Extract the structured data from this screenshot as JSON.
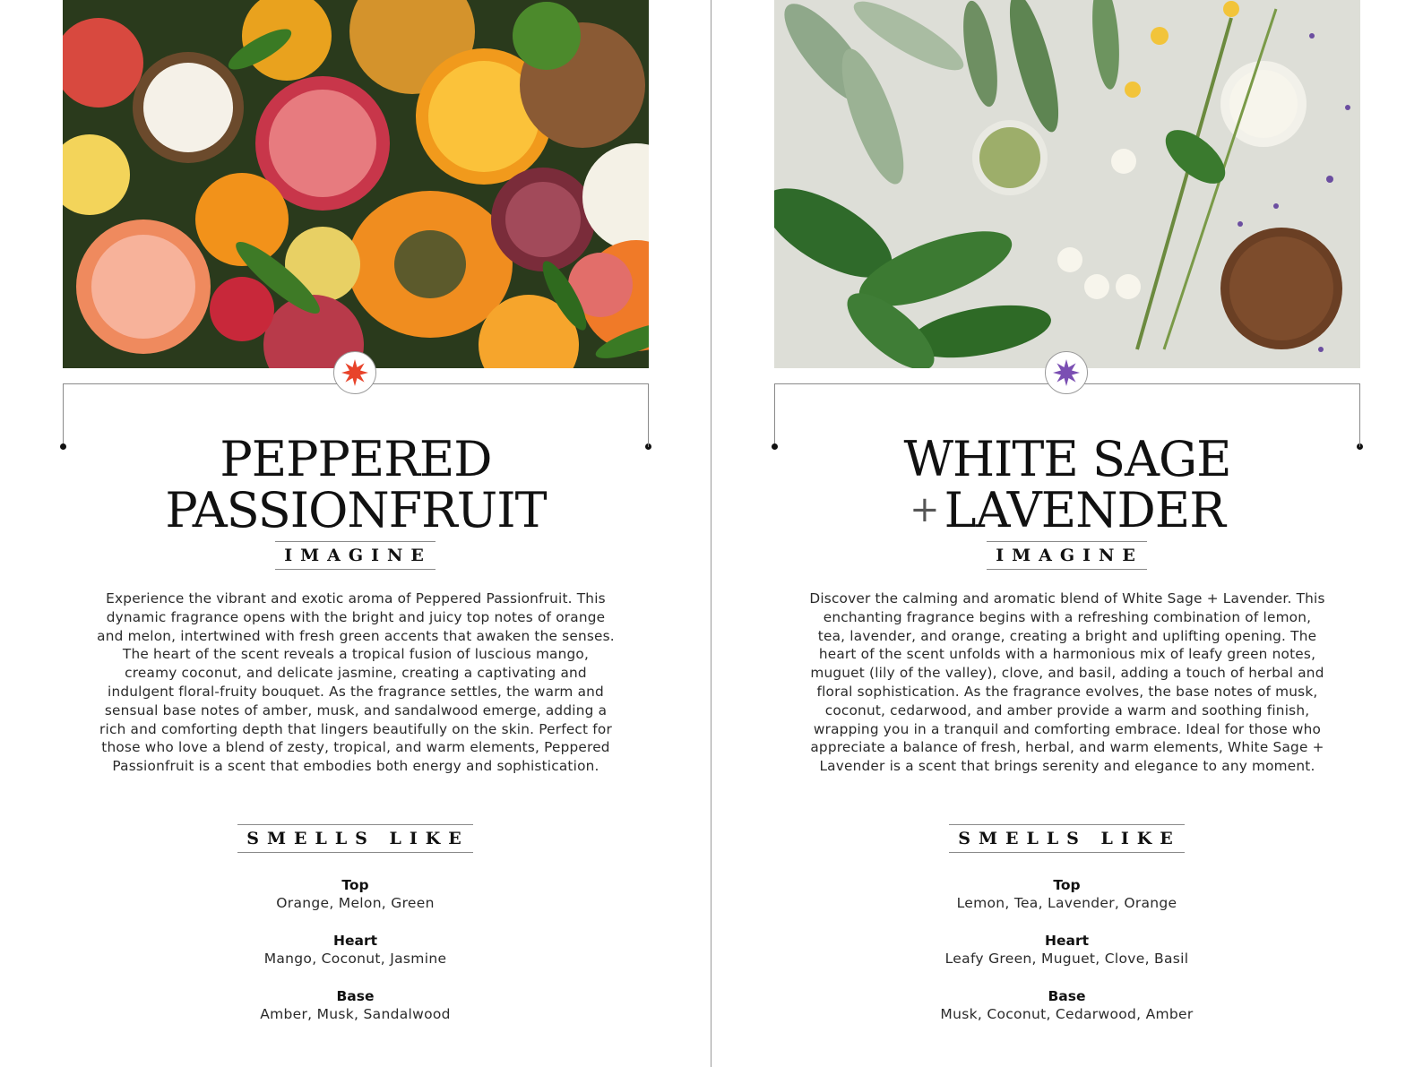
{
  "colors": {
    "left_badge_star": "#e8432a",
    "right_badge_star": "#7b4fb3",
    "text": "#222222",
    "rule": "#8a8a8a"
  },
  "cards": [
    {
      "photo": "tropical-fruit-photo",
      "badge_icon": "star-burst-icon",
      "title_line1": "PEPPERED",
      "title_line2": "PASSIONFRUIT",
      "imagine_label": "IMAGINE",
      "description": "Experience the vibrant and exotic aroma of Peppered Passionfruit. This dynamic fragrance opens with the bright and juicy top notes of orange and melon, intertwined with fresh green accents that awaken the senses. The heart of the scent reveals a tropical fusion of luscious mango, creamy coconut, and delicate jasmine, creat­ing a captivating and indulgent floral-fruity bouquet. As the fra­grance settles, the warm and sensual base notes of amber, musk, and sandalwood emerge, adding a rich and comforting depth that lingers beautifully on the skin. Perfect for those who love a blend of zesty, tropical, and warm elements, Peppered Passionfruit is a scent that embodies both energy and sophistication.",
      "smells_label": "SMELLS LIKE",
      "notes": [
        {
          "head": "Top",
          "body": "Orange, Melon, Green"
        },
        {
          "head": "Heart",
          "body": "Mango, Coconut, Jasmine"
        },
        {
          "head": "Base",
          "body": "Amber, Musk, Sandalwood"
        }
      ]
    },
    {
      "photo": "herbs-and-lavender-photo",
      "badge_icon": "star-burst-icon",
      "title_line1": "WHITE SAGE",
      "title_plus": "+",
      "title_line2": "LAVENDER",
      "imagine_label": "IMAGINE",
      "description": "Discover the calming and aromatic blend of White Sage + Lavender. This enchanting fragrance begins with a refreshing com­bination of lemon, tea, lavender, and orange, creating a bright and uplifting opening. The heart of the scent unfolds with a harmonious mix of leafy green notes, muguet (lily of the valley), clove, and basil, adding a touch of herbal and floral sophistication. As the fragrance evolves, the base notes of musk, coconut, cedarwood, and amber provide a warm and soothing finish, wrapping you in a tranquil and comforting embrace. Ideal for those who appreciate a balance of fresh, herbal, and warm elements, White Sage + Lavender is a scent that brings serenity and elegance to any moment.",
      "smells_label": "SMELLS LIKE",
      "notes": [
        {
          "head": "Top",
          "body": "Lemon, Tea, Lavender, Orange"
        },
        {
          "head": "Heart",
          "body": "Leafy Green, Muguet, Clove, Basil"
        },
        {
          "head": "Base",
          "body": "Musk, Coconut, Cedarwood, Amber"
        }
      ]
    }
  ]
}
